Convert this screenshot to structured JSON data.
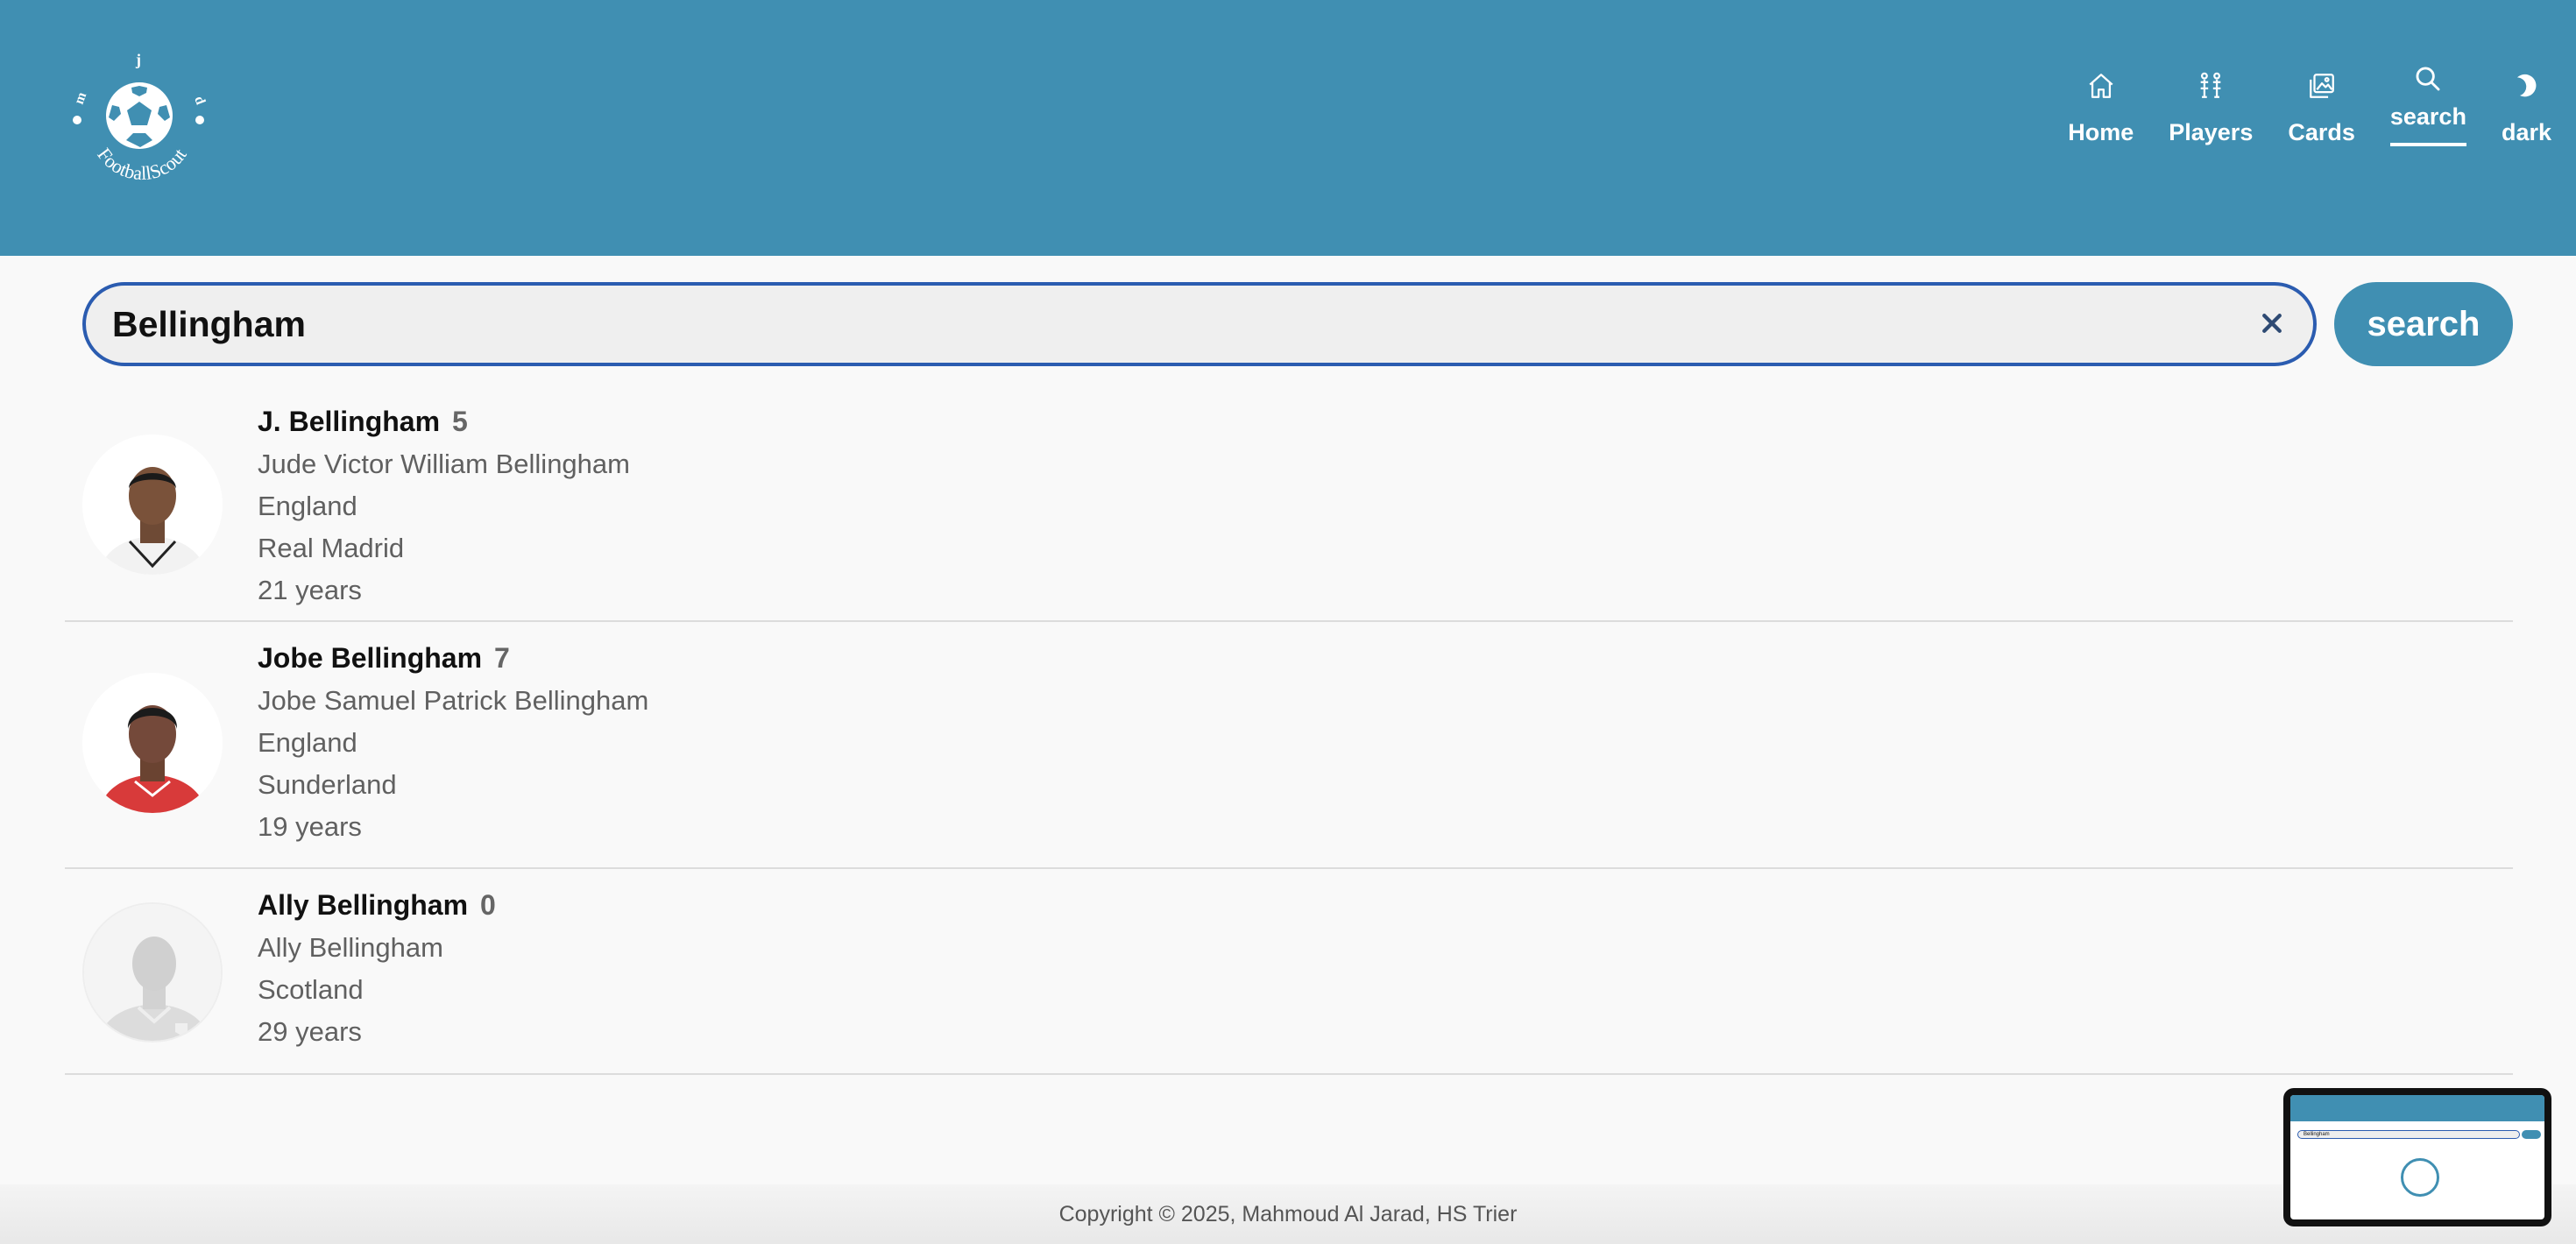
{
  "brand": {
    "name": "FootballScout",
    "letters": [
      "j",
      "m",
      "d"
    ]
  },
  "nav": {
    "items": [
      {
        "label": "Home",
        "icon": "home-icon"
      },
      {
        "label": "Players",
        "icon": "players-icon"
      },
      {
        "label": "Cards",
        "icon": "cards-icon"
      },
      {
        "label": "search",
        "icon": "search-icon",
        "active": true
      },
      {
        "label": "dark",
        "icon": "moon-icon"
      }
    ]
  },
  "search": {
    "value": "Bellingham",
    "clear": "×",
    "button": "search"
  },
  "results": [
    {
      "short_name": "J. Bellingham",
      "number": "5",
      "full_name": "Jude Victor William Bellingham",
      "nation": "England",
      "club": "Real Madrid",
      "age": "21 years"
    },
    {
      "short_name": "Jobe Bellingham",
      "number": "7",
      "full_name": "Jobe Samuel Patrick Bellingham",
      "nation": "England",
      "club": "Sunderland",
      "age": "19 years"
    },
    {
      "short_name": "Ally Bellingham",
      "number": "0",
      "full_name": "Ally Bellingham",
      "nation": "Scotland",
      "age": "29 years"
    }
  ],
  "footer": {
    "text": "Copyright © 2025, Mahmoud Al Jarad, HS Trier"
  },
  "thumbnail": {
    "search_value": "Bellingham"
  },
  "colors": {
    "header": "#408fb2",
    "accent_border": "#2b5cb0",
    "background": "#f9f9f9"
  }
}
